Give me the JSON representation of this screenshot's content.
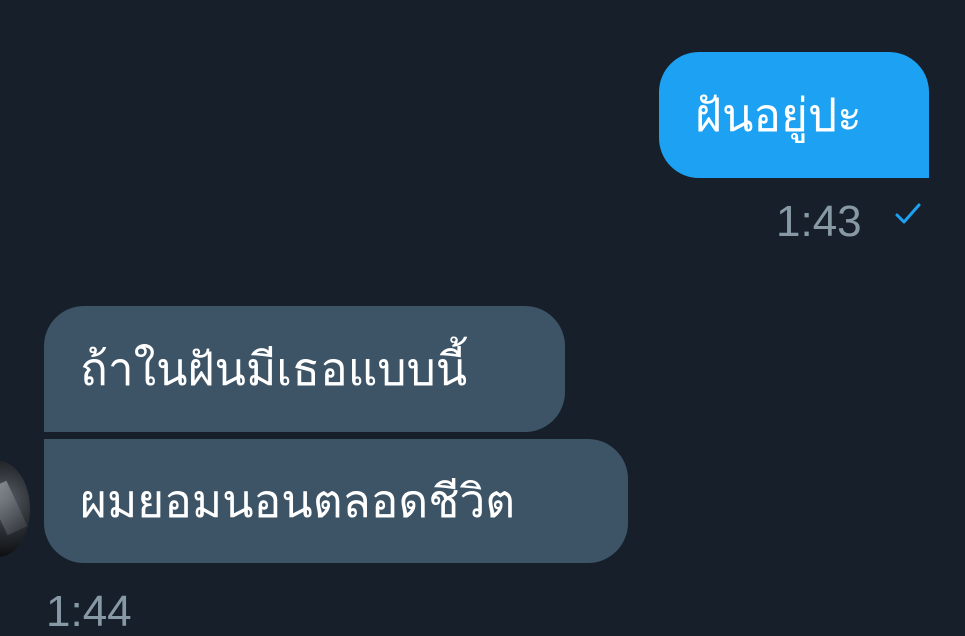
{
  "messages": {
    "outgoing": {
      "text": "ฝันอยู่ปะ",
      "time": "1:43",
      "status_icon": "single-check-icon"
    },
    "incoming": [
      {
        "text": "ถ้าในฝันมีเธอแบบนี้"
      },
      {
        "text": "ผมยอมนอนตลอดชีวิต"
      }
    ],
    "incoming_time": "1:44"
  },
  "colors": {
    "background": "#17202a",
    "outgoing_bubble": "#1da1f2",
    "incoming_bubble": "#3d5466",
    "timestamp": "#8899a6",
    "check": "#1da1f2"
  }
}
